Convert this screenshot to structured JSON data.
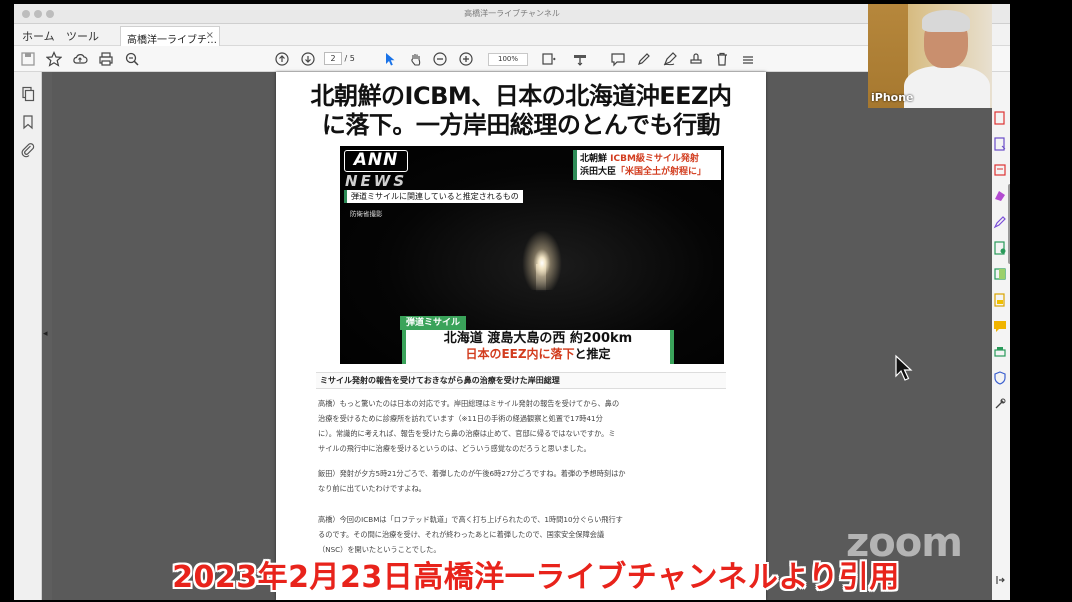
{
  "window": {
    "title": "高橋洋一ライブチャンネル"
  },
  "menu": {
    "home_label": "ホーム",
    "tools_label": "ツール",
    "doc_tab_label": "高橋洋一ライブチ…",
    "doc_tab_close": "×"
  },
  "toolbar": {
    "page_current": "2",
    "page_total": "/ 5",
    "zoom_level": "100%"
  },
  "document": {
    "headline_line1": "北朝鮮のICBM、日本の北海道沖EEZ内",
    "headline_line2": "に落下。一方岸田総理のとんでも行動",
    "news_image": {
      "logo": "ANN",
      "news_word": "NEWS",
      "caption_related": "弾道ミサイルに関連していると推定されるもの",
      "caption_source": "防衛省撮影",
      "top_right_line1_prefix": "北朝鮮",
      "top_right_line1_red": "ICBM級ミサイル発射",
      "top_right_line2_prefix": "浜田大臣",
      "top_right_line2_red": "「米国全土が射程に」",
      "tag": "弾道ミサイル",
      "lower_line1": "北海道 渡島大島の西 約200km",
      "lower_line2_red": "日本のEEZ内に落下",
      "lower_line2_suffix": "と推定"
    },
    "subheading": "ミサイル発射の報告を受けておきながら鼻の治療を受けた岸田総理",
    "paragraphs": [
      "高橋）もっと驚いたのは日本の対応です。岸田総理はミサイル発射の報告を受けてから、鼻の",
      "治療を受けるために診療所を訪れています（※11日の手術の経過観察と処置で17時41分",
      "に）。常識的に考えれば、報告を受けたら鼻の治療は止めて、官邸に帰るではないですか。ミ",
      "サイルの飛行中に治療を受けるというのは、どういう感覚なのだろうと思いました。",
      "飯田）発射が夕方5時21分ごろで、着弾したのが午後6時27分ごろですね。着弾の予想時刻はか",
      "なり前に出ていたわけですよね。",
      "高橋）今回のICBMは「ロフテッド軌道」で高く打ち上げられたので、1時間10分ぐらい飛行す",
      "るのです。その間に治療を受け、それが終わったあとに着弾したので、国家安全保障会議",
      "（NSC）を開いたということでした。"
    ]
  },
  "overlay": {
    "zoom_watermark": "zoom",
    "camera_label": "iPhone",
    "caption": "2023年2月23日高橋洋一ライブチャンネルより引用"
  },
  "colors": {
    "caption_red": "#e8231b",
    "news_green": "#3aa35a",
    "news_red": "#d23c1e",
    "toolbar_blue": "#1a73e8"
  }
}
